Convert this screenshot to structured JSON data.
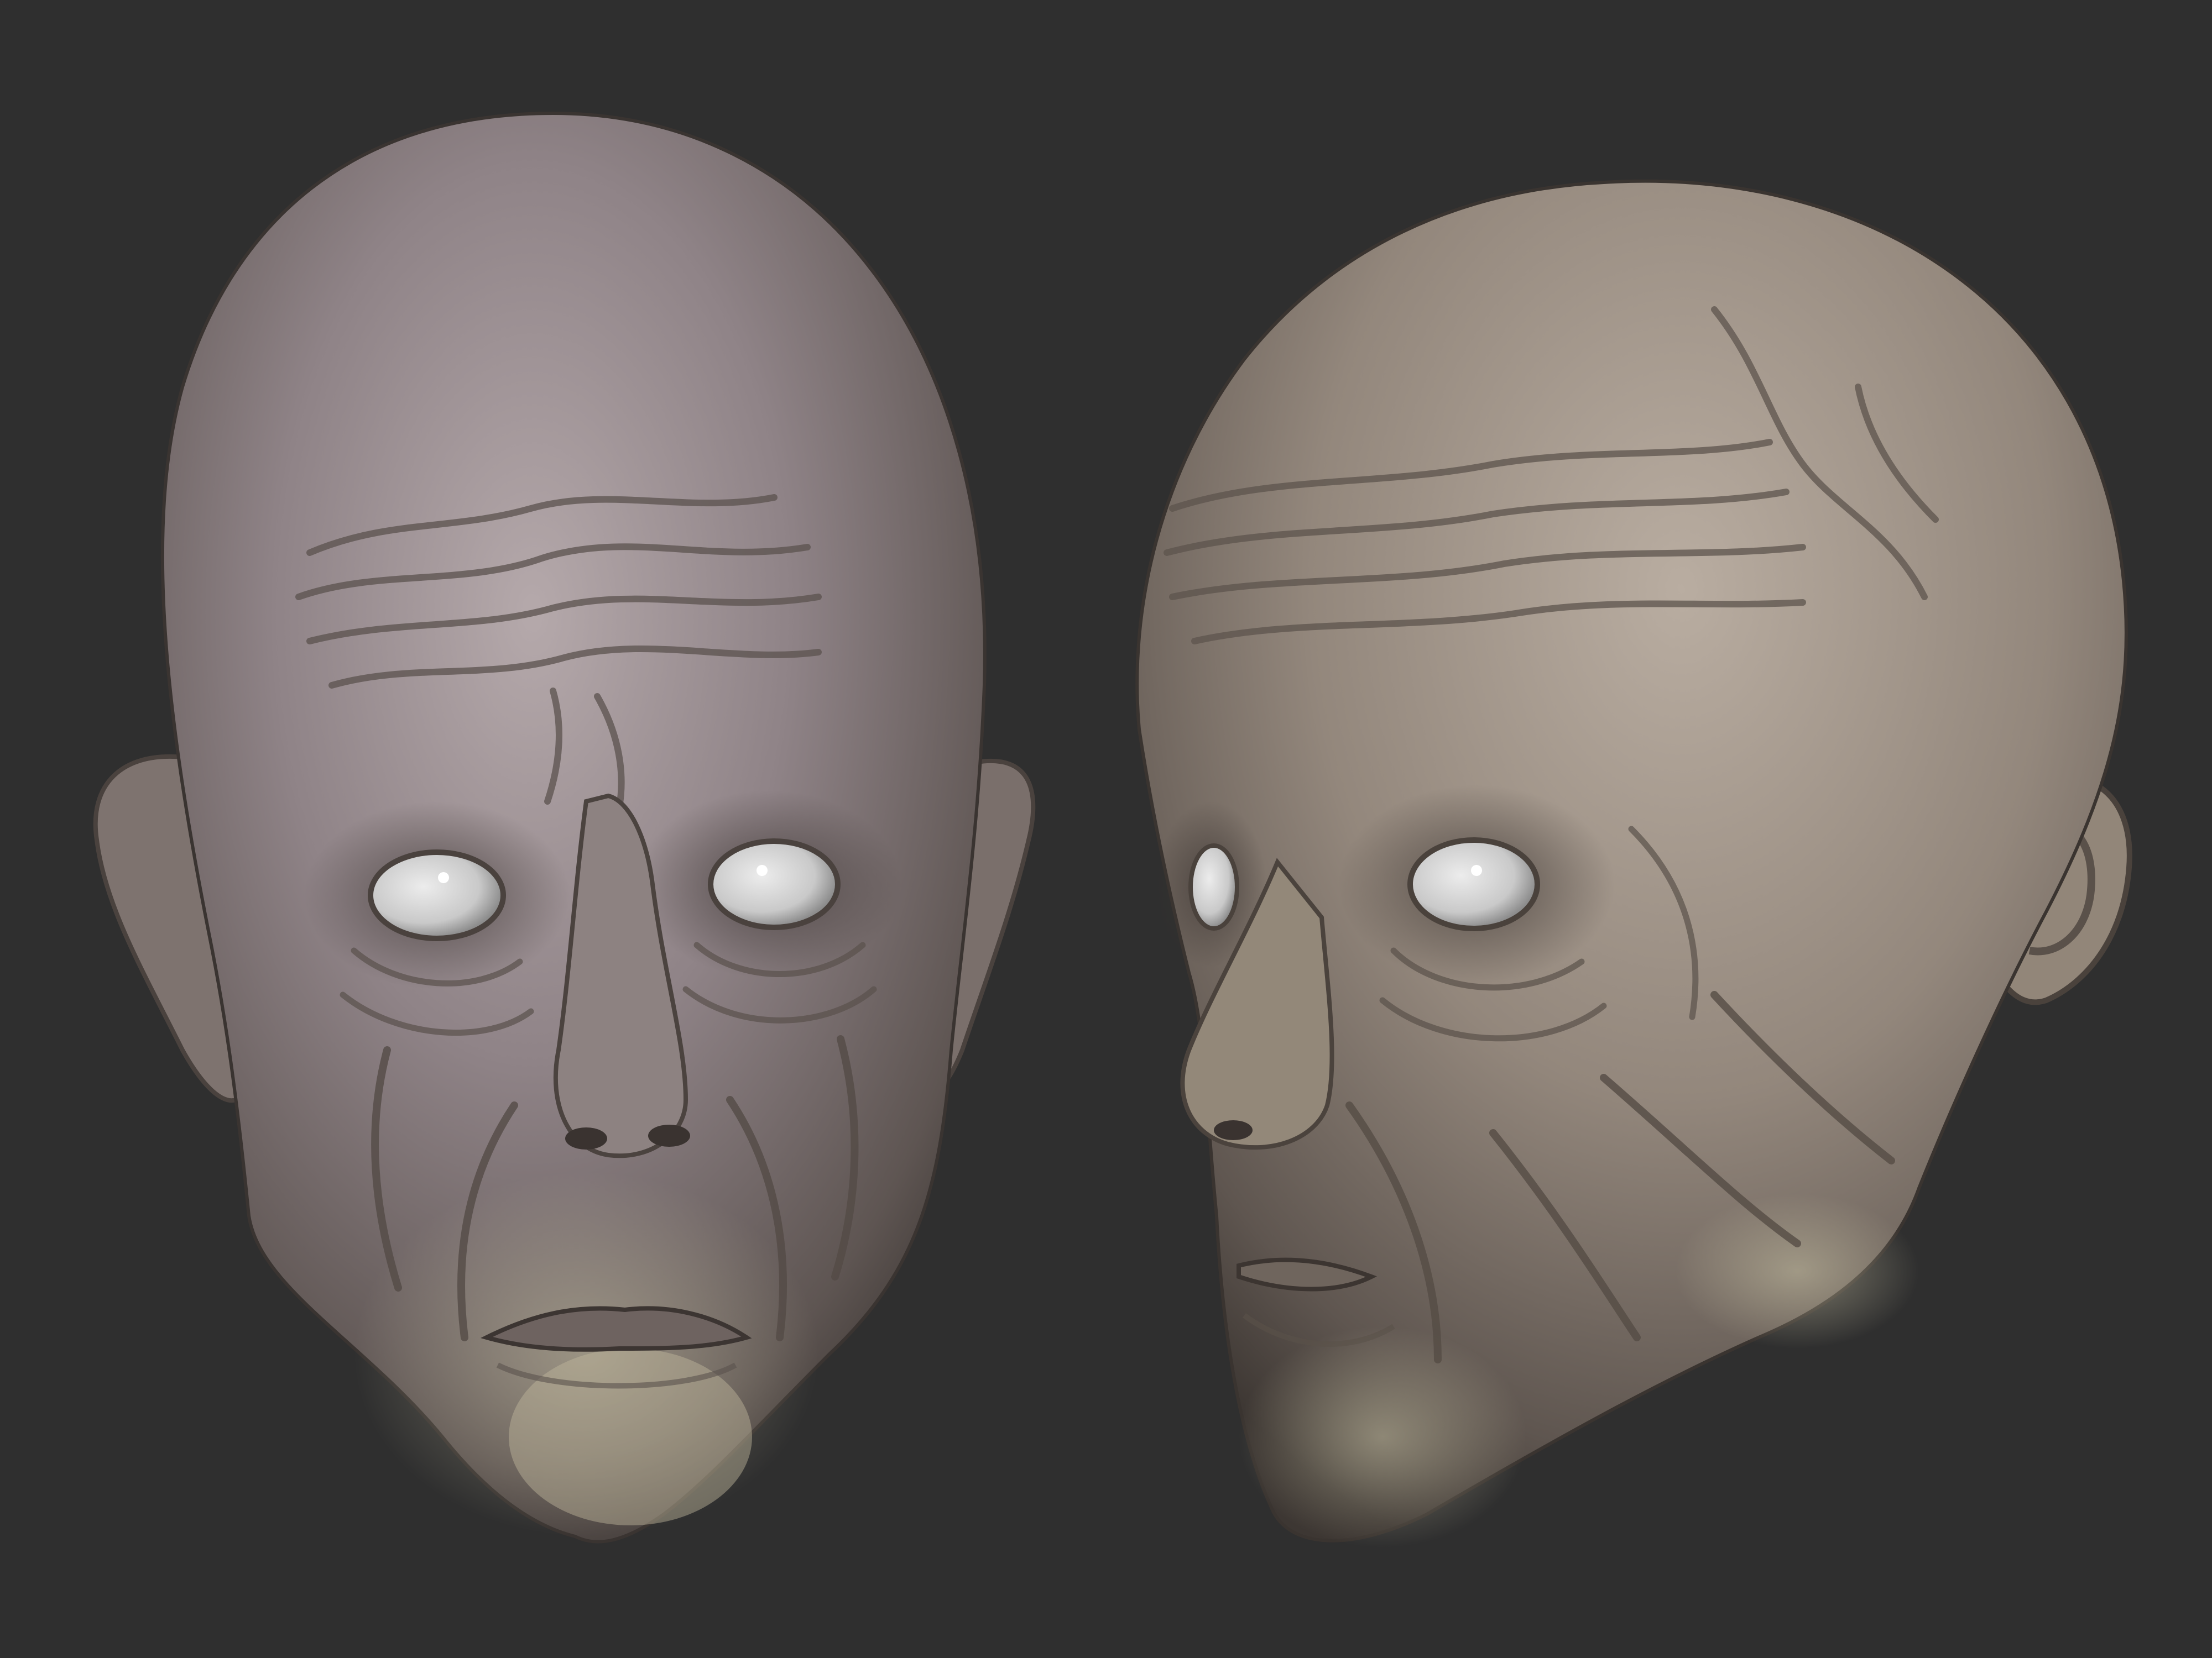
{
  "scene": {
    "background_color": "#2f2f2f",
    "subjects": [
      {
        "id": "front-view",
        "description_visible_text": ""
      },
      {
        "id": "three-quarter-view",
        "description_visible_text": ""
      }
    ]
  },
  "colors": {
    "skin_base": "#8d8178",
    "skin_light": "#b7aba1",
    "skin_shadow": "#4e4640",
    "skin_purple_tint": "#a093a4",
    "skin_yellow_tint": "#b4ad93",
    "eye_white": "#d9d9d9",
    "eye_shadow": "#8a8a8a",
    "crease": "#5a524b"
  }
}
